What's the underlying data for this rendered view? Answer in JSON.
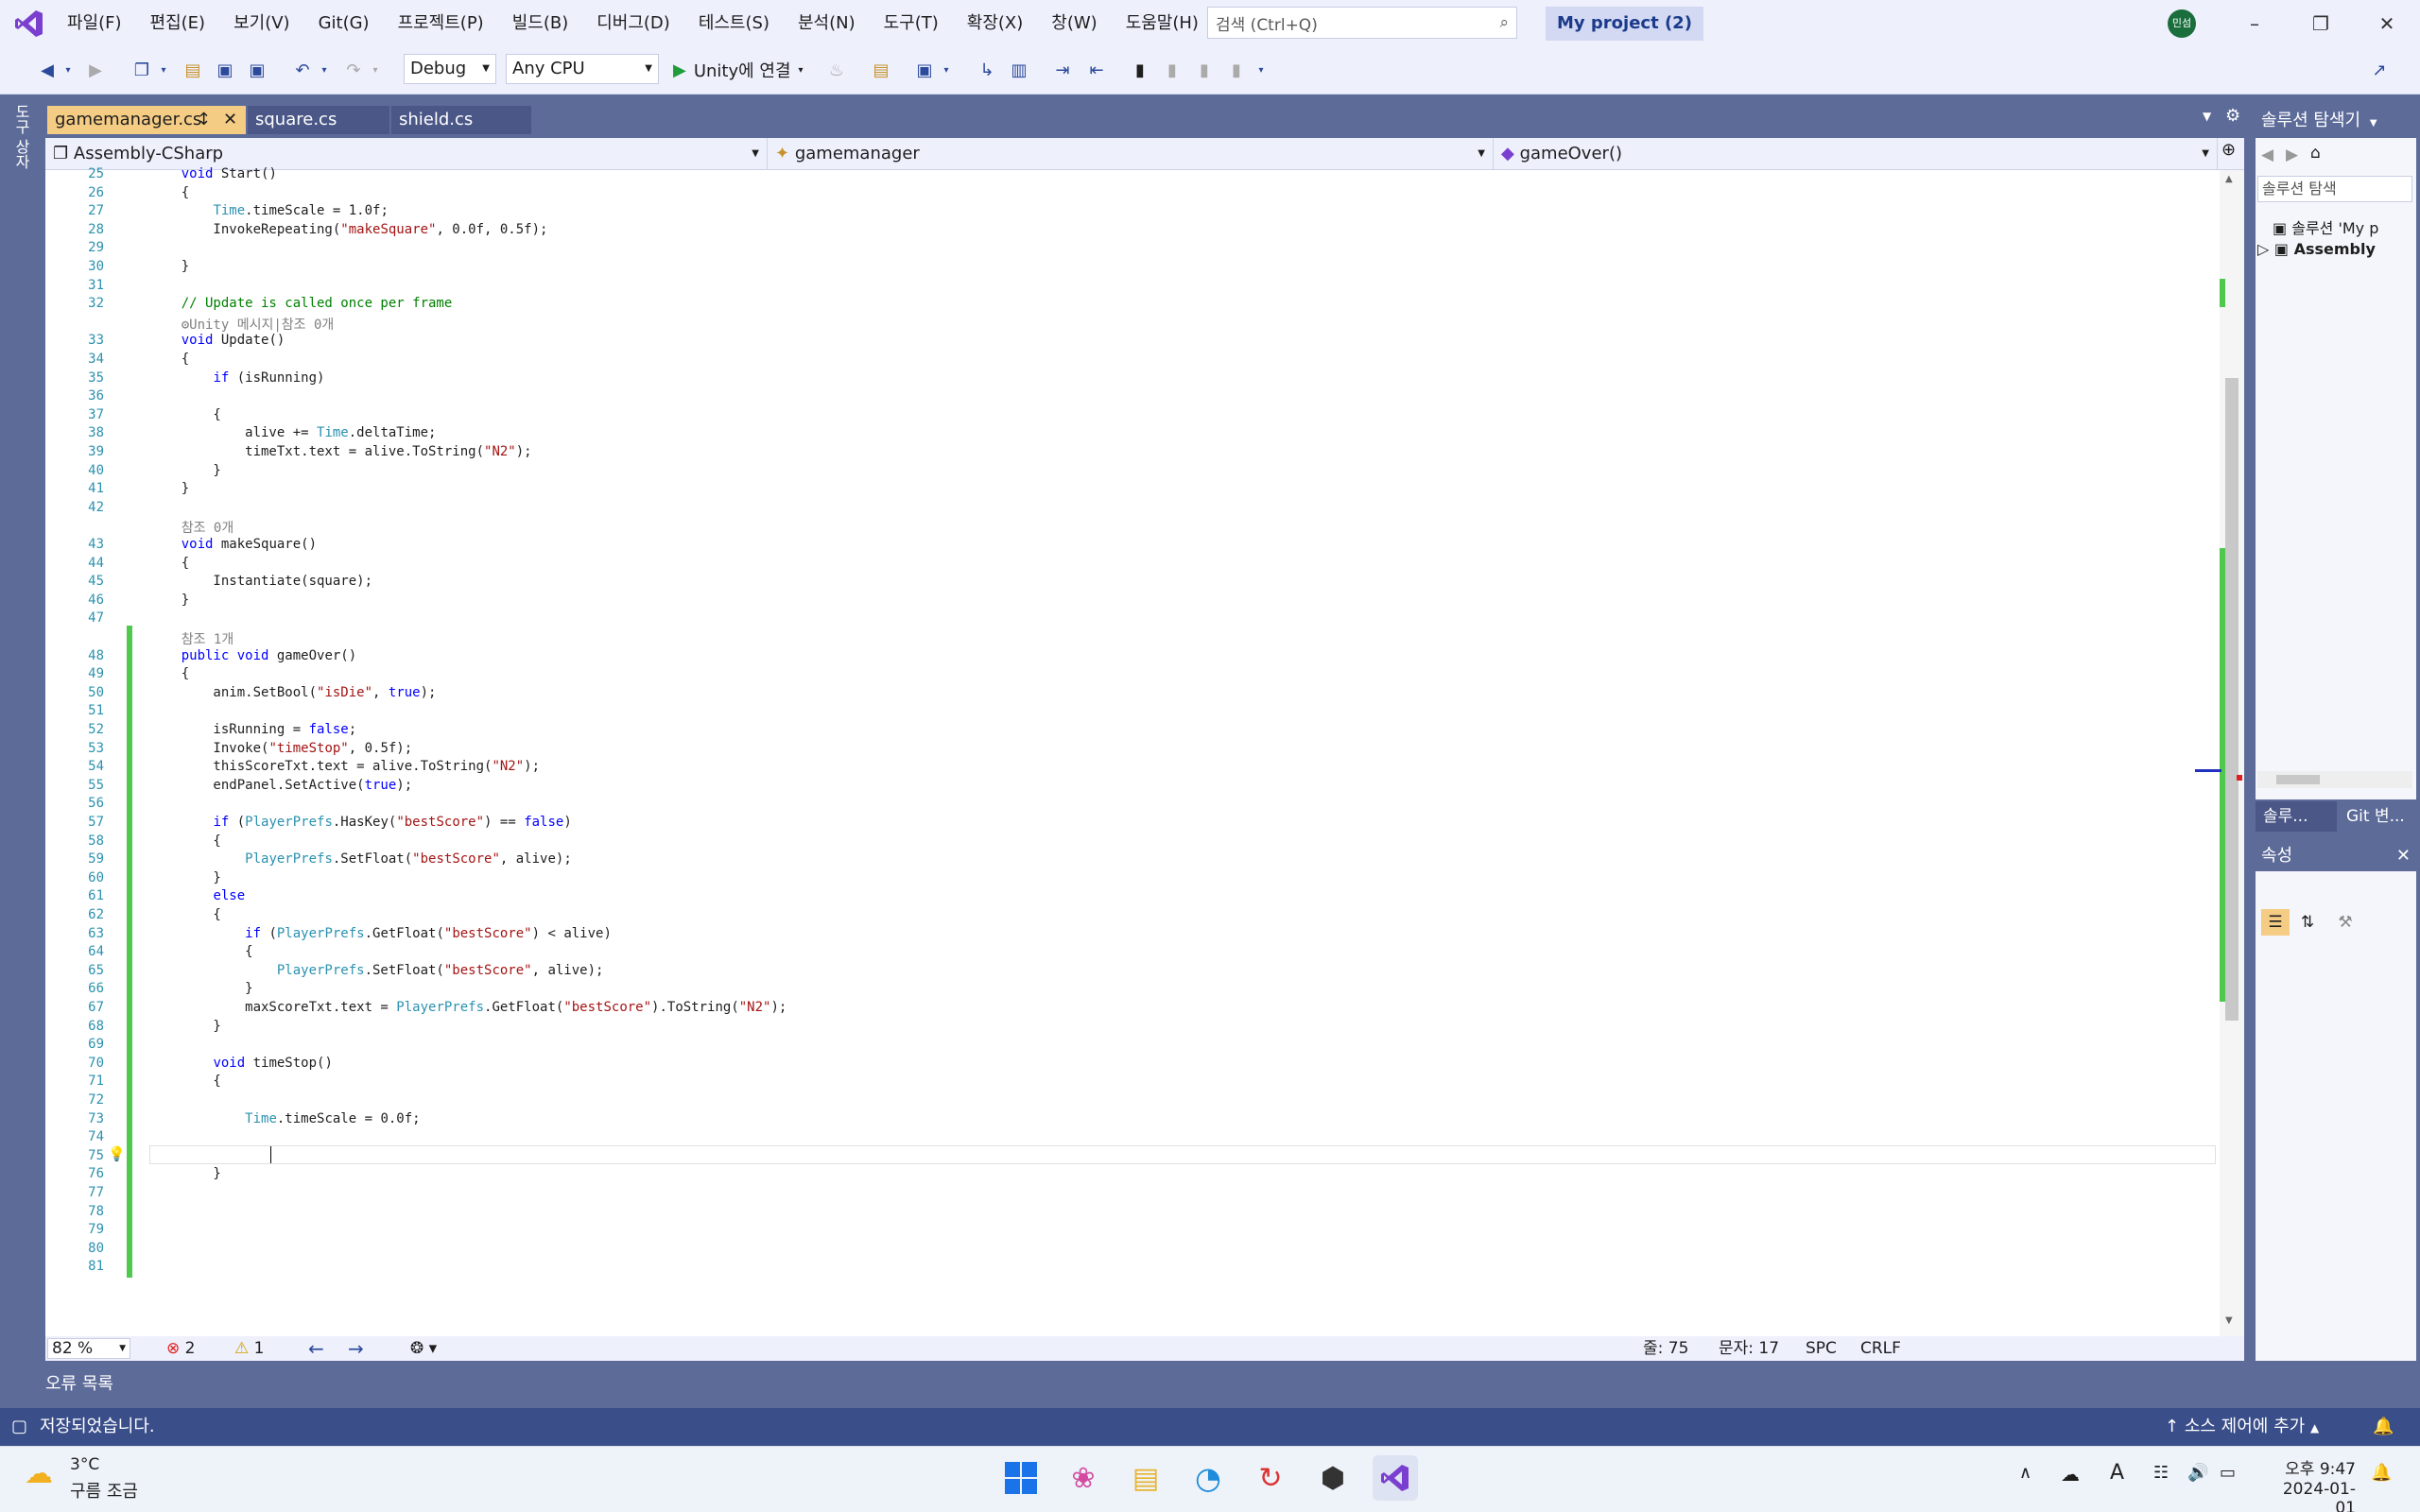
{
  "titlebar": {
    "menus": [
      "파일(F)",
      "편집(E)",
      "보기(V)",
      "Git(G)",
      "프로젝트(P)",
      "빌드(B)",
      "디버그(D)",
      "테스트(S)",
      "분석(N)",
      "도구(T)",
      "확장(X)",
      "창(W)",
      "도움말(H)"
    ],
    "search_placeholder": "검색 (Ctrl+Q)",
    "project_name": "My project (2)",
    "user_initials": "민섬"
  },
  "toolbar": {
    "config": "Debug",
    "platform": "Any CPU",
    "run_label": "Unity에 연결"
  },
  "left_strip": {
    "label": "도구 상자"
  },
  "tabs": [
    {
      "label": "gamemanager.cs",
      "active": true
    },
    {
      "label": "square.cs",
      "active": false
    },
    {
      "label": "shield.cs",
      "active": false
    }
  ],
  "navbar": {
    "project": "Assembly-CSharp",
    "class": "gamemanager",
    "member": "gameOver()"
  },
  "code_lines": [
    {
      "n": "25",
      "t": "    void Start()"
    },
    {
      "n": "26",
      "t": "    {"
    },
    {
      "n": "27",
      "t": "        Time.timeScale = 1.0f;"
    },
    {
      "n": "28",
      "t": "        InvokeRepeating(\"makeSquare\", 0.0f, 0.5f);"
    },
    {
      "n": "29",
      "t": ""
    },
    {
      "n": "30",
      "t": "    }"
    },
    {
      "n": "31",
      "t": ""
    },
    {
      "n": "32",
      "t": "    // Update is called once per frame"
    },
    {
      "n": "",
      "t": "    ⚙Unity 메시지|참조 0개"
    },
    {
      "n": "33",
      "t": "    void Update()"
    },
    {
      "n": "34",
      "t": "    {"
    },
    {
      "n": "35",
      "t": "        if (isRunning)"
    },
    {
      "n": "36",
      "t": ""
    },
    {
      "n": "37",
      "t": "        {"
    },
    {
      "n": "38",
      "t": "            alive += Time.deltaTime;"
    },
    {
      "n": "39",
      "t": "            timeTxt.text = alive.ToString(\"N2\");"
    },
    {
      "n": "40",
      "t": "        }"
    },
    {
      "n": "41",
      "t": "    }"
    },
    {
      "n": "42",
      "t": ""
    },
    {
      "n": "",
      "t": "    참조 0개"
    },
    {
      "n": "43",
      "t": "    void makeSquare()"
    },
    {
      "n": "44",
      "t": "    {"
    },
    {
      "n": "45",
      "t": "        Instantiate(square);"
    },
    {
      "n": "46",
      "t": "    }"
    },
    {
      "n": "47",
      "t": ""
    },
    {
      "n": "",
      "t": "    참조 1개"
    },
    {
      "n": "48",
      "t": "    public void gameOver()"
    },
    {
      "n": "49",
      "t": "    {"
    },
    {
      "n": "50",
      "t": "        anim.SetBool(\"isDie\", true);"
    },
    {
      "n": "51",
      "t": ""
    },
    {
      "n": "52",
      "t": "        isRunning = false;"
    },
    {
      "n": "53",
      "t": "        Invoke(\"timeStop\", 0.5f);"
    },
    {
      "n": "54",
      "t": "        thisScoreTxt.text = alive.ToString(\"N2\");"
    },
    {
      "n": "55",
      "t": "        endPanel.SetActive(true);"
    },
    {
      "n": "56",
      "t": ""
    },
    {
      "n": "57",
      "t": "        if (PlayerPrefs.HasKey(\"bestScore\") == false)"
    },
    {
      "n": "58",
      "t": "        {"
    },
    {
      "n": "59",
      "t": "            PlayerPrefs.SetFloat(\"bestScore\", alive);"
    },
    {
      "n": "60",
      "t": "        }"
    },
    {
      "n": "61",
      "t": "        else"
    },
    {
      "n": "62",
      "t": "        {"
    },
    {
      "n": "63",
      "t": "            if (PlayerPrefs.GetFloat(\"bestScore\") < alive)"
    },
    {
      "n": "64",
      "t": "            {"
    },
    {
      "n": "65",
      "t": "                PlayerPrefs.SetFloat(\"bestScore\", alive);"
    },
    {
      "n": "66",
      "t": "            }"
    },
    {
      "n": "67",
      "t": "            maxScoreTxt.text = PlayerPrefs.GetFloat(\"bestScore\").ToString(\"N2\");"
    },
    {
      "n": "68",
      "t": "        }"
    },
    {
      "n": "69",
      "t": ""
    },
    {
      "n": "70",
      "t": "        void timeStop()"
    },
    {
      "n": "71",
      "t": "        {"
    },
    {
      "n": "72",
      "t": ""
    },
    {
      "n": "73",
      "t": "            Time.timeScale = 0.0f;"
    },
    {
      "n": "74",
      "t": ""
    },
    {
      "n": "75",
      "t": ""
    },
    {
      "n": "76",
      "t": "        }"
    },
    {
      "n": "77",
      "t": ""
    },
    {
      "n": "78",
      "t": ""
    },
    {
      "n": "79",
      "t": ""
    },
    {
      "n": "80",
      "t": ""
    },
    {
      "n": "81",
      "t": ""
    }
  ],
  "editor_status": {
    "zoom": "82 %",
    "errors": "2",
    "warnings": "1",
    "line": "줄: 75",
    "col": "문자: 17",
    "spc": "SPC",
    "eol": "CRLF"
  },
  "solution_explorer": {
    "title": "솔루션 탐색기",
    "search": "솔루션 탐색",
    "solution_item": "솔루션 'My p",
    "assembly_item": "Assembly",
    "tab1": "솔루...",
    "tab2": "Git 변..."
  },
  "properties": {
    "title": "속성"
  },
  "output_tab": "오류 목록",
  "status": {
    "message": "저장되었습니다.",
    "source_control": "소스 제어에 추가"
  },
  "taskbar": {
    "temp": "3°C",
    "weather": "구름 조금",
    "time": "오후 9:47",
    "date": "2024-01-01"
  },
  "colors": {
    "accent": "#5d6b99",
    "tab_active": "#f5cc84",
    "status": "#3a4e8a"
  }
}
